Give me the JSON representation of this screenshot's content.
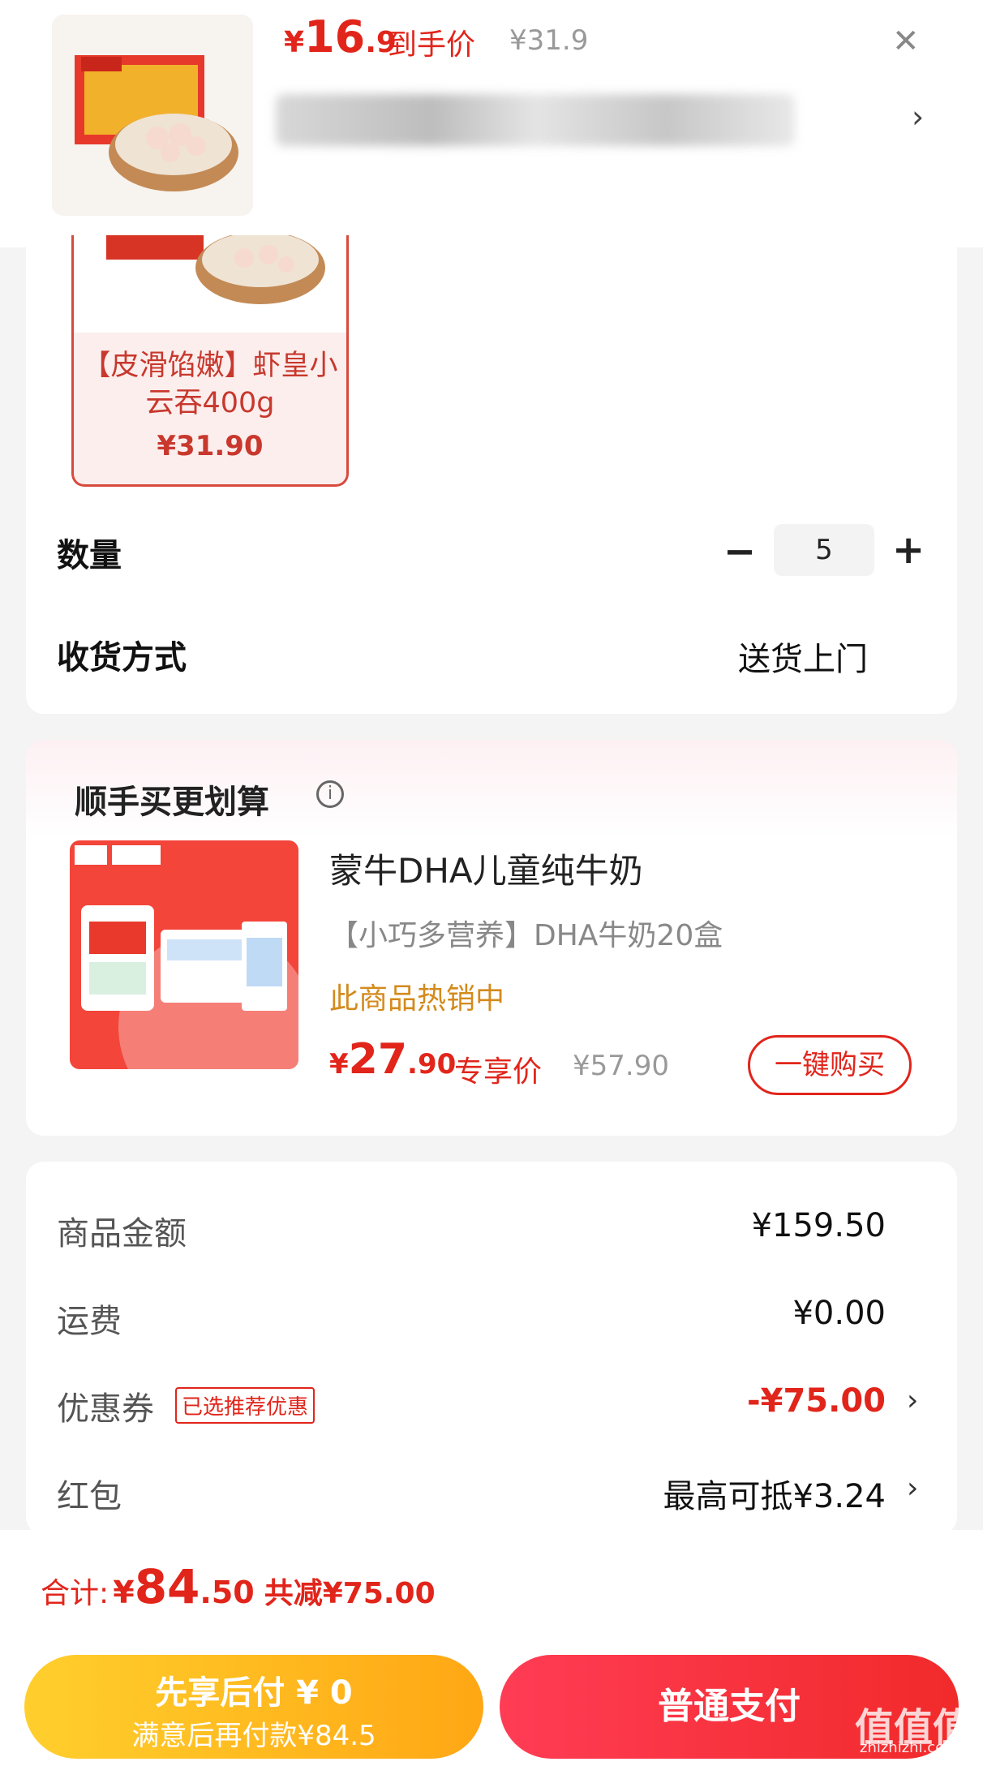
{
  "header": {
    "price_yen": "¥",
    "price_int": "16",
    "price_dec": ".9",
    "price_tag": "到手价",
    "original_price": "¥31.9",
    "close_glyph": "✕",
    "address_chevron": "›"
  },
  "sku": {
    "title": "【皮滑馅嫩】虾皇小云吞400g",
    "price": "¥31.90"
  },
  "quantity": {
    "label": "数量",
    "minus": "−",
    "value": "5",
    "plus": "+"
  },
  "delivery": {
    "label": "收货方式",
    "value": "送货上门"
  },
  "upsell": {
    "title": "顺手买更划算",
    "info_glyph": "i",
    "name": "蒙牛DHA儿童纯牛奶",
    "subtitle": "【小巧多营养】DHA牛奶20盒",
    "hot": "此商品热销中",
    "price_yen": "¥",
    "price_int": "27",
    "price_dec": ".90",
    "price_tag": "专享价",
    "original_price": "¥57.90",
    "buy_label": "一键购买"
  },
  "summary": {
    "goods_label": "商品金额",
    "goods_value": "¥159.50",
    "shipping_label": "运费",
    "shipping_value": "¥0.00",
    "coupon_label": "优惠券",
    "coupon_badge": "已选推荐优惠",
    "coupon_value": "-¥75.00",
    "redpacket_label": "红包",
    "redpacket_value": "最高可抵¥3.24",
    "chevron": "›"
  },
  "footer": {
    "total_label": "合计:",
    "total_yen": "¥",
    "total_int": "84",
    "total_dec": ".50",
    "saved": "共减¥75.00",
    "later_line1": "先享后付 ¥ 0",
    "later_line2": "满意后再付款¥84.5",
    "pay_label": "普通支付"
  },
  "watermark": {
    "text": "值值值",
    "url": "zhizhizhi.com"
  },
  "colors": {
    "accent_red": "#e1251b",
    "gold": "#d48a1c",
    "later_button": "#ffb81f"
  }
}
